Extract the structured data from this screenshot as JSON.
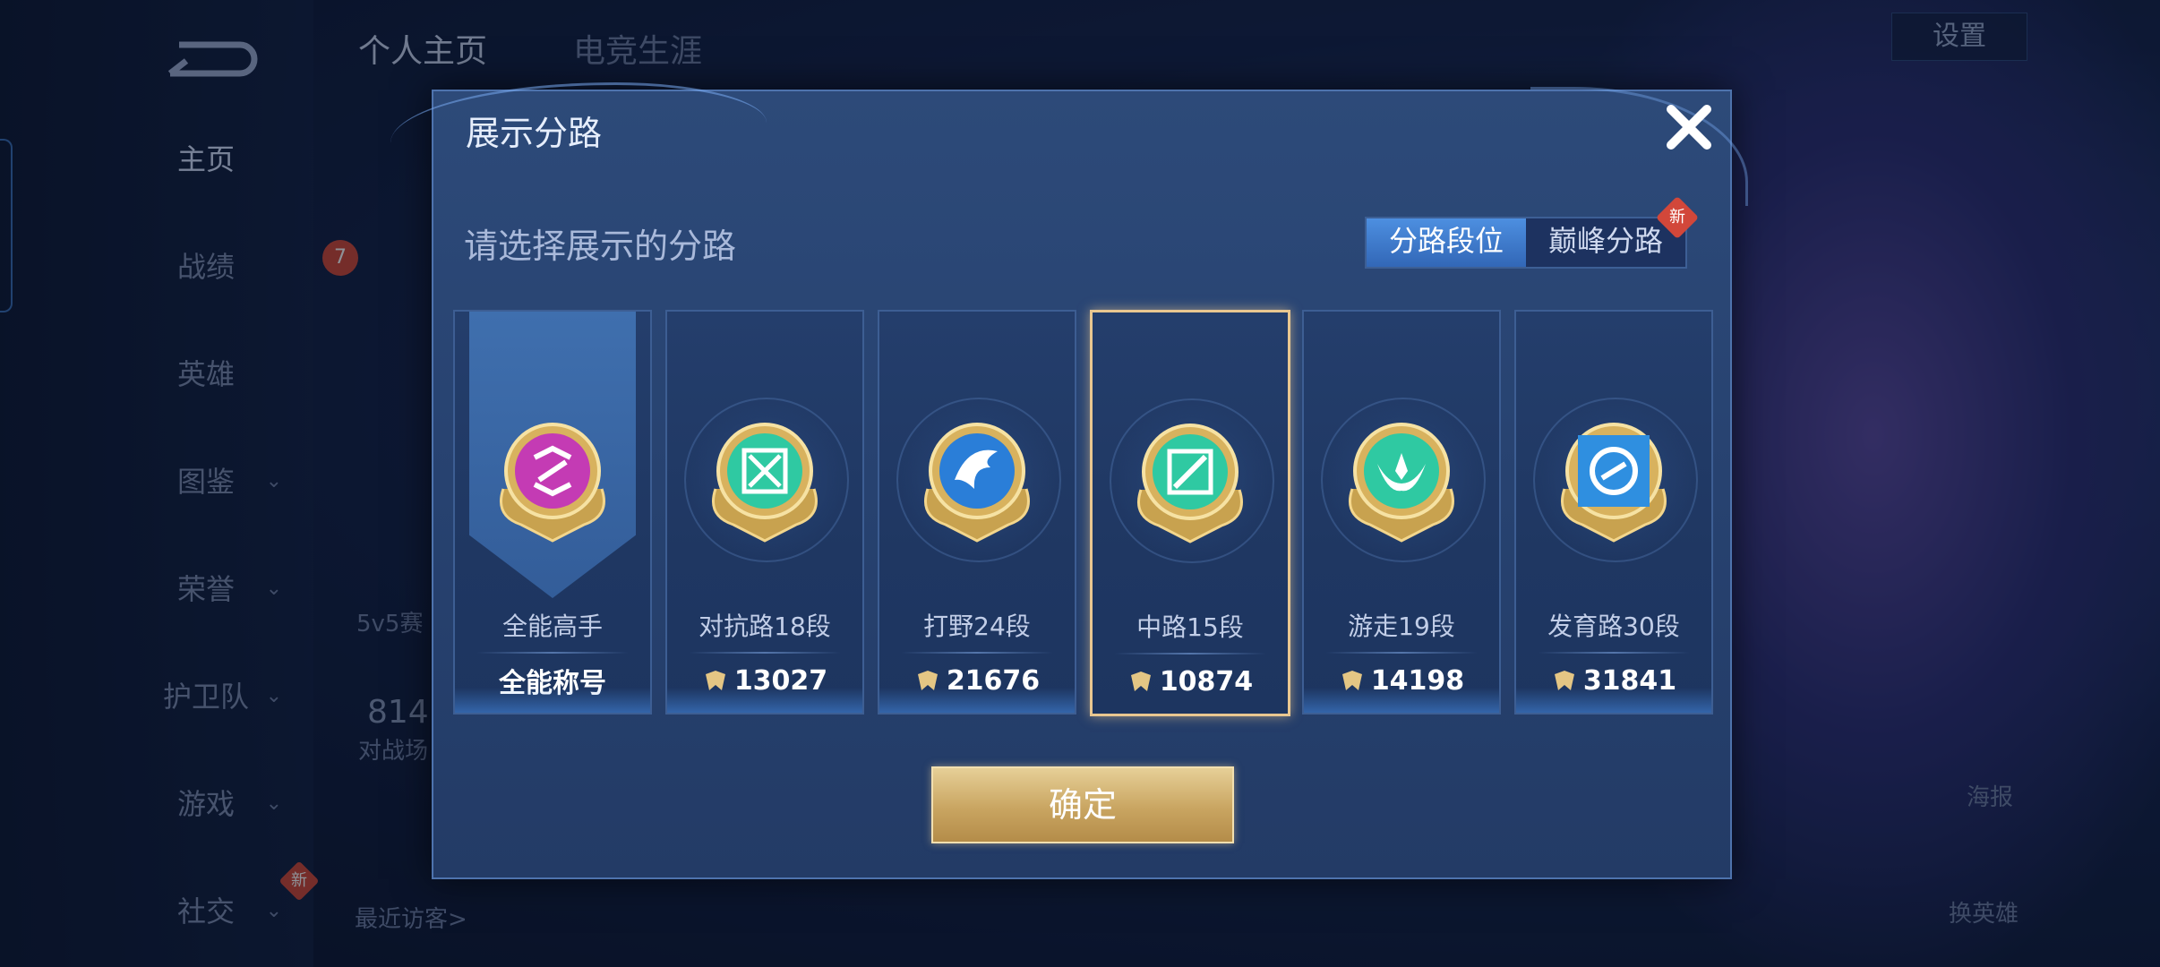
{
  "background": {
    "top_tabs": [
      "个人主页",
      "电竞生涯"
    ],
    "nav": [
      {
        "label": "主页",
        "expandable": false
      },
      {
        "label": "战绩",
        "expandable": false
      },
      {
        "label": "英雄",
        "expandable": false
      },
      {
        "label": "图鉴",
        "expandable": true
      },
      {
        "label": "荣誉",
        "expandable": true
      },
      {
        "label": "护卫队",
        "expandable": true
      },
      {
        "label": "游戏",
        "expandable": true
      },
      {
        "label": "社交",
        "expandable": true
      }
    ],
    "settings_label": "设置",
    "visitors_label": "最近访客>",
    "mode_label": "5v5赛",
    "stat_value": "814",
    "stat_label": "对战场",
    "poster_label": "海报",
    "change_hero_label": "换英雄",
    "level_badge": "7",
    "new_badge": "新"
  },
  "modal": {
    "title": "展示分路",
    "subtitle": "请选择展示的分路",
    "toggle": {
      "options": [
        "分路段位",
        "巅峰分路"
      ],
      "active_index": 0,
      "new_badge": "新"
    },
    "lanes": [
      {
        "name": "全能高手",
        "value": "全能称号",
        "badge_icon": "all-round-badge-icon",
        "color": "#c43bb4",
        "selected": false,
        "show_points_icon": false
      },
      {
        "name": "对抗路18段",
        "value": "13027",
        "badge_icon": "clash-lane-badge-icon",
        "color": "#2fc9a2",
        "selected": false,
        "show_points_icon": true
      },
      {
        "name": "打野24段",
        "value": "21676",
        "badge_icon": "jungle-badge-icon",
        "color": "#2a7ed8",
        "selected": false,
        "show_points_icon": true
      },
      {
        "name": "中路15段",
        "value": "10874",
        "badge_icon": "mid-lane-badge-icon",
        "color": "#2fc9a2",
        "selected": true,
        "show_points_icon": true
      },
      {
        "name": "游走19段",
        "value": "14198",
        "badge_icon": "roam-badge-icon",
        "color": "#2fc9a2",
        "selected": false,
        "show_points_icon": true
      },
      {
        "name": "发育路30段",
        "value": "31841",
        "badge_icon": "farm-lane-badge-icon",
        "color": "#2f8fe0",
        "selected": false,
        "show_points_icon": true
      }
    ],
    "confirm_label": "确定"
  }
}
